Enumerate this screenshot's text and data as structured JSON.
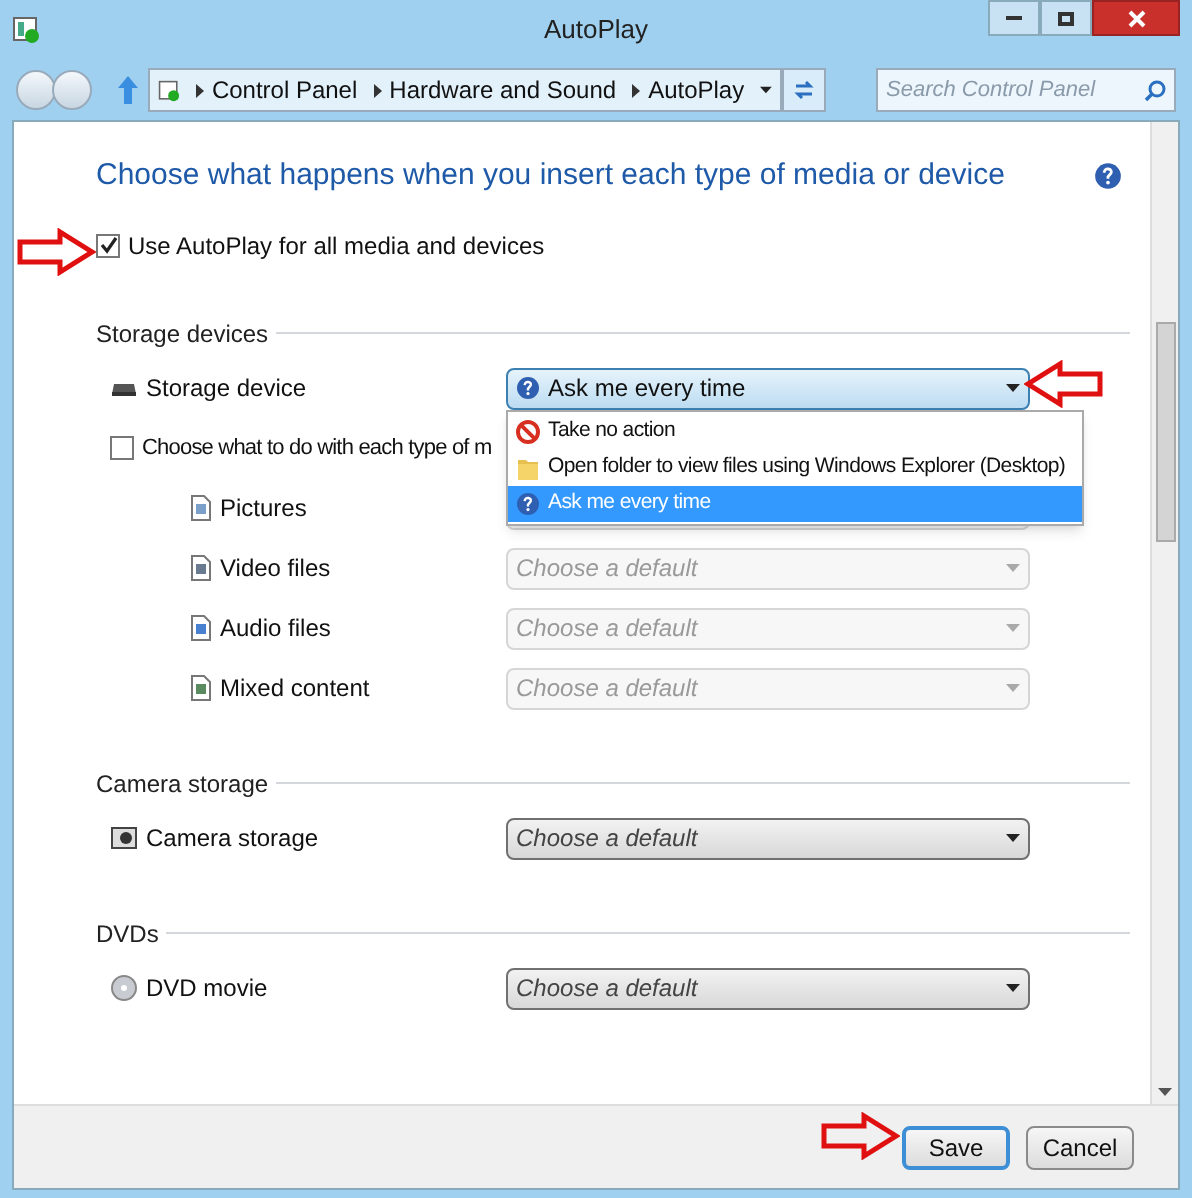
{
  "window": {
    "title": "AutoPlay"
  },
  "address_bar": {
    "breadcrumbs": [
      "Control Panel",
      "Hardware and Sound",
      "AutoPlay"
    ]
  },
  "search": {
    "placeholder": "Search Control Panel"
  },
  "heading": "Choose what happens when you insert each type of media or device",
  "use_autoplay": {
    "label": "Use AutoPlay for all media and devices",
    "checked": true
  },
  "sections": [
    {
      "title": "Storage devices",
      "rows": [
        {
          "kind": "device",
          "label": "Storage device",
          "value": "Ask me every time",
          "disabled": false,
          "expanded": true,
          "options": [
            {
              "label": "Take no action",
              "selected": false
            },
            {
              "label": "Open folder to view files using Windows Explorer (Desktop)",
              "selected": false
            },
            {
              "label": "Ask me every time",
              "selected": true
            }
          ]
        },
        {
          "kind": "checkbox",
          "label": "Choose what to do with each type of m",
          "checked": false
        },
        {
          "kind": "media",
          "label": "Pictures",
          "disabled": true
        },
        {
          "kind": "media",
          "label": "Video files",
          "value": "Choose a default",
          "disabled": true
        },
        {
          "kind": "media",
          "label": "Audio files",
          "value": "Choose a default",
          "disabled": true
        },
        {
          "kind": "media",
          "label": "Mixed content",
          "value": "Choose a default",
          "disabled": true
        }
      ]
    },
    {
      "title": "Camera storage",
      "rows": [
        {
          "kind": "device",
          "label": "Camera storage",
          "value": "Choose a default",
          "disabled": false,
          "expanded": false
        }
      ]
    },
    {
      "title": "DVDs",
      "rows": [
        {
          "kind": "device",
          "label": "DVD movie",
          "value": "Choose a default",
          "disabled": false,
          "expanded": false
        }
      ]
    }
  ],
  "buttons": [
    {
      "label": "Save",
      "default": true
    },
    {
      "label": "Cancel",
      "default": false
    }
  ]
}
